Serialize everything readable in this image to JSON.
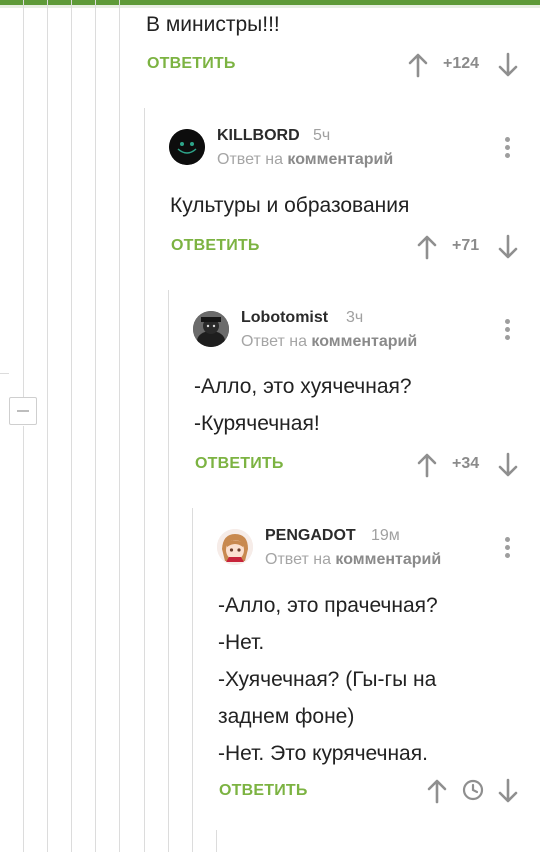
{
  "comments": [
    {
      "text_lines": [
        "В министры!!!"
      ],
      "reply_label": "ОТВЕТИТЬ",
      "score": "+124"
    },
    {
      "author": "KILLBORD",
      "time": "5ч",
      "meta_prefix": "Ответ на",
      "meta_link": "комментарий",
      "text_lines": [
        "Культуры и образования"
      ],
      "reply_label": "ОТВЕТИТЬ",
      "score": "+71"
    },
    {
      "author": "Lobotomist",
      "time": "3ч",
      "meta_prefix": "Ответ на",
      "meta_link": "комментарий",
      "text_lines": [
        "-Алло, это хуячечная?",
        "-Курячечная!"
      ],
      "reply_label": "ОТВЕТИТЬ",
      "score": "+34"
    },
    {
      "author": "PENGADOT",
      "time": "19м",
      "meta_prefix": "Ответ на",
      "meta_link": "комментарий",
      "text_lines": [
        "-Алло, это прачечная?",
        "-Нет.",
        "-Хуячечная? (Гы-гы на",
        "заднем фоне)",
        "-Нет. Это курячечная."
      ],
      "reply_label": "ОТВЕТИТЬ"
    }
  ],
  "colors": {
    "accent": "#7cb342",
    "topbar": "#5e9a38"
  },
  "icons": [
    "arrow-up-icon",
    "arrow-down-icon",
    "clock-icon",
    "more-vertical-icon",
    "collapse-minus-icon"
  ]
}
